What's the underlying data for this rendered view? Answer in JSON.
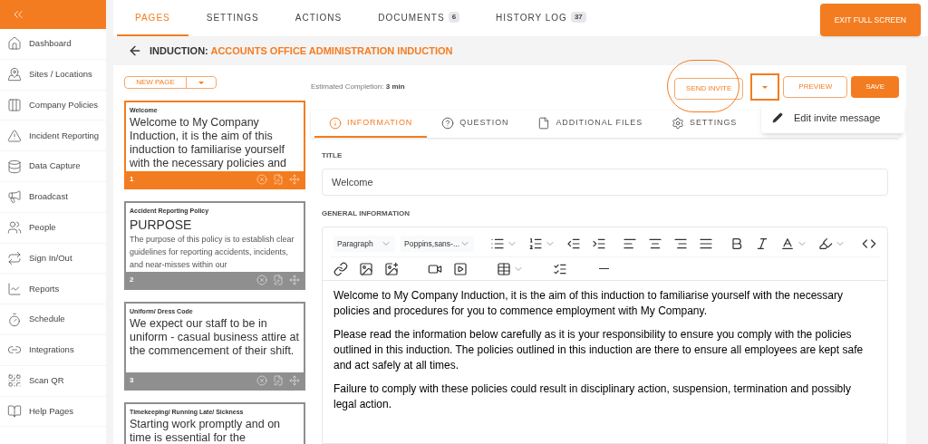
{
  "sidebar": {
    "items": [
      {
        "label": "Dashboard",
        "kind": "home"
      },
      {
        "label": "Sites / Locations",
        "kind": "map"
      },
      {
        "label": "Company Policies",
        "kind": "policies"
      },
      {
        "label": "Incident Reporting",
        "kind": "alert"
      },
      {
        "label": "Data Capture",
        "kind": "data"
      },
      {
        "label": "Broadcast",
        "kind": "broadcast"
      },
      {
        "label": "People",
        "kind": "people"
      },
      {
        "label": "Sign In/Out",
        "kind": "signin"
      },
      {
        "label": "Reports",
        "kind": "reports"
      },
      {
        "label": "Schedule",
        "kind": "schedule"
      },
      {
        "label": "Integrations",
        "kind": "integrations"
      },
      {
        "label": "Scan QR",
        "kind": "qr"
      },
      {
        "label": "Help Pages",
        "kind": "help"
      }
    ]
  },
  "tabs": [
    {
      "label": "PAGES",
      "selected": true
    },
    {
      "label": "SETTINGS",
      "selected": false
    },
    {
      "label": "ACTIONS",
      "selected": false
    },
    {
      "label": "DOCUMENTS",
      "count": "6",
      "selected": false
    },
    {
      "label": "HISTORY LOG",
      "count": "37",
      "selected": false
    }
  ],
  "exit_button": "EXIT FULL SCREEN",
  "breadcrumb": {
    "prefix": "INDUCTION:",
    "title": "ACCOUNTS OFFICE ADMINISTRATION INDUCTION"
  },
  "new_page_button": "NEW PAGE",
  "pages": [
    {
      "number": "1",
      "title": "Welcome",
      "body": "Welcome to My Company Induction, it is the aim of this induction to familiarise yourself with the necessary policies and",
      "selected": true
    },
    {
      "number": "2",
      "title": "Accident Reporting Policy",
      "heading": "PURPOSE",
      "body": "The purpose of this policy is to establish clear guidelines for reporting accidents, incidents, and near-misses within our",
      "selected": false
    },
    {
      "number": "3",
      "title": "Uniform/ Dress Code",
      "body": "We expect our staff to be in uniform - casual business attire at the commencement of their shift.",
      "selected": false
    },
    {
      "title": "Timekeeping/ Running Late/ Sickness",
      "body": "Starting work promptly and on time is essential for the",
      "selected": false
    }
  ],
  "estimated": {
    "label": "Estimated Completion:",
    "value": "3 min"
  },
  "actions": {
    "send_invite": "SEND INVITE",
    "preview": "PREVIEW",
    "save": "SAVE",
    "menu": {
      "expanded": true,
      "items": [
        "Edit invite message"
      ]
    }
  },
  "editor_tabs": [
    {
      "label": "INFORMATION",
      "kind": "info",
      "selected": true
    },
    {
      "label": "QUESTION",
      "kind": "question",
      "selected": false
    },
    {
      "label": "ADDITIONAL FILES",
      "kind": "file",
      "selected": false
    },
    {
      "label": "SETTINGS",
      "kind": "settings",
      "selected": false
    }
  ],
  "title_field": {
    "label": "TITLE",
    "value": "Welcome"
  },
  "general_information": {
    "label": "GENERAL INFORMATION",
    "block_format": "Paragraph",
    "font": "Poppins,sans-...",
    "paragraphs": [
      "Welcome to My Company Induction, it is the aim of this induction to familiarise yourself with the necessary policies and procedures for you to commence employment with My Company.",
      "Please read the information below carefully as it is your responsibility to ensure you comply with the policies outlined in this induction. The policies outlined in this induction are there to ensure all employees are kept safe and act safely at all times.",
      "Failure to comply with these policies could result in disciplinary action, suspension, termination and possibly legal action."
    ]
  }
}
